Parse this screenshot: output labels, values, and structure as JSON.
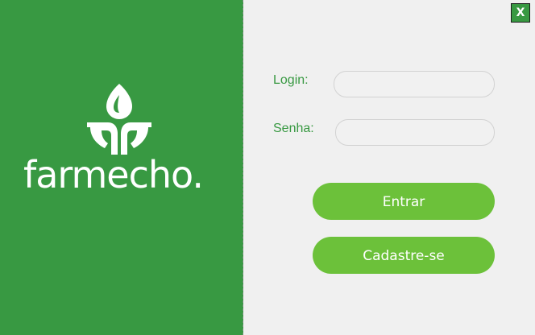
{
  "window": {
    "close_label": "X"
  },
  "brand": {
    "logo_icon": "sprout-leaves-icon",
    "logo_text": "farmecho."
  },
  "form": {
    "login_label": "Login:",
    "login_value": "",
    "senha_label": "Senha:",
    "senha_value": "",
    "entrar_label": "Entrar",
    "cadastro_label": "Cadastre-se"
  },
  "colors": {
    "brand_green": "#389942",
    "button_green": "#6cc13a",
    "label_green": "#389942",
    "background": "#f0f0f0"
  }
}
